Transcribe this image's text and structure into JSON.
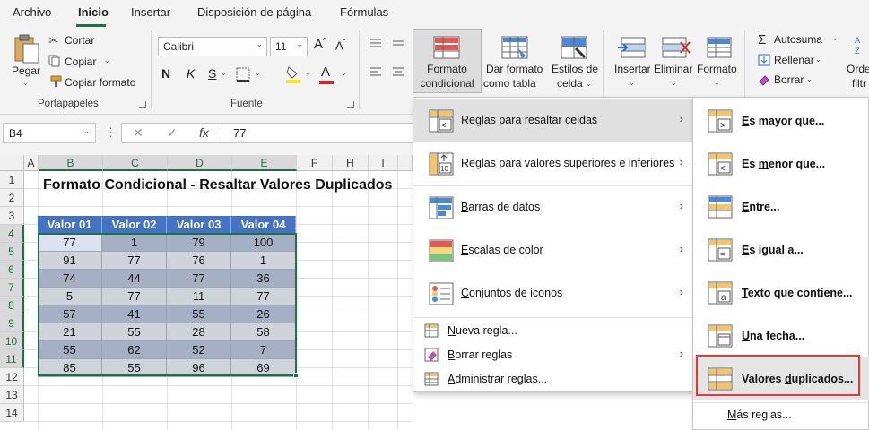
{
  "menubar": {
    "tabs": [
      "Archivo",
      "Inicio",
      "Insertar",
      "Disposición de página",
      "Fórmulas"
    ],
    "active": "Inicio"
  },
  "ribbon": {
    "paste": "Pegar",
    "cut": "Cortar",
    "copy": "Copiar",
    "format_painter": "Copiar formato",
    "clipboard_group": "Portapapeles",
    "font_name": "Calibri",
    "font_size": "11",
    "font_group": "Fuente",
    "conditional_format_line1": "Formato",
    "conditional_format_line2": "condicional",
    "format_table_line1": "Dar formato",
    "format_table_line2": "como tabla",
    "cell_styles_line1": "Estilos de",
    "cell_styles_line2": "celda",
    "insert": "Insertar",
    "delete": "Eliminar",
    "format": "Formato",
    "autosum": "Autosuma",
    "fill": "Rellenar",
    "clear": "Borrar",
    "sort_line1": "Orde",
    "sort_line2": "filtr"
  },
  "formula_bar": {
    "name_box": "B4",
    "value": "77",
    "fx": "fx"
  },
  "grid": {
    "columns": [
      "A",
      "B",
      "C",
      "D",
      "E",
      "F",
      "H",
      "I"
    ],
    "rows": [
      "1",
      "2",
      "3",
      "4",
      "5",
      "6",
      "7",
      "8",
      "9",
      "10",
      "11",
      "12",
      "13",
      "14"
    ],
    "title": "Formato Condicional - Resaltar Valores Duplicados",
    "headers": [
      "Valor 01",
      "Valor 02",
      "Valor 03",
      "Valor 04"
    ],
    "data": [
      [
        "77",
        "1",
        "79",
        "100"
      ],
      [
        "91",
        "77",
        "76",
        "1"
      ],
      [
        "74",
        "44",
        "77",
        "36"
      ],
      [
        "5",
        "77",
        "11",
        "77"
      ],
      [
        "57",
        "41",
        "55",
        "26"
      ],
      [
        "21",
        "55",
        "28",
        "58"
      ],
      [
        "55",
        "62",
        "52",
        "7"
      ],
      [
        "85",
        "55",
        "96",
        "69"
      ]
    ]
  },
  "menu": {
    "items": [
      {
        "label": "Reglas para resaltar celdas",
        "icon": "highlight-rules-icon"
      },
      {
        "label": "Reglas para valores superiores e inferiores",
        "icon": "top-bottom-rules-icon"
      },
      {
        "label": "Barras de datos",
        "icon": "data-bars-icon"
      },
      {
        "label": "Escalas de color",
        "icon": "color-scales-icon"
      },
      {
        "label": "Conjuntos de iconos",
        "icon": "icon-sets-icon"
      }
    ],
    "small_items": [
      {
        "label": "Nueva regla...",
        "icon": "new-rule-icon"
      },
      {
        "label": "Borrar reglas",
        "icon": "clear-rules-icon"
      },
      {
        "label": "Administrar reglas...",
        "icon": "manage-rules-icon"
      }
    ]
  },
  "submenu": {
    "items": [
      "Es mayor que...",
      "Es menor que...",
      "Entre...",
      "Es igual a...",
      "Texto que contiene...",
      "Una fecha...",
      "Valores duplicados..."
    ],
    "more": "Más reglas..."
  },
  "colors": {
    "accent": "#1e7145",
    "header_blue": "#4472c4",
    "highlight_red": "#e03a3a"
  }
}
